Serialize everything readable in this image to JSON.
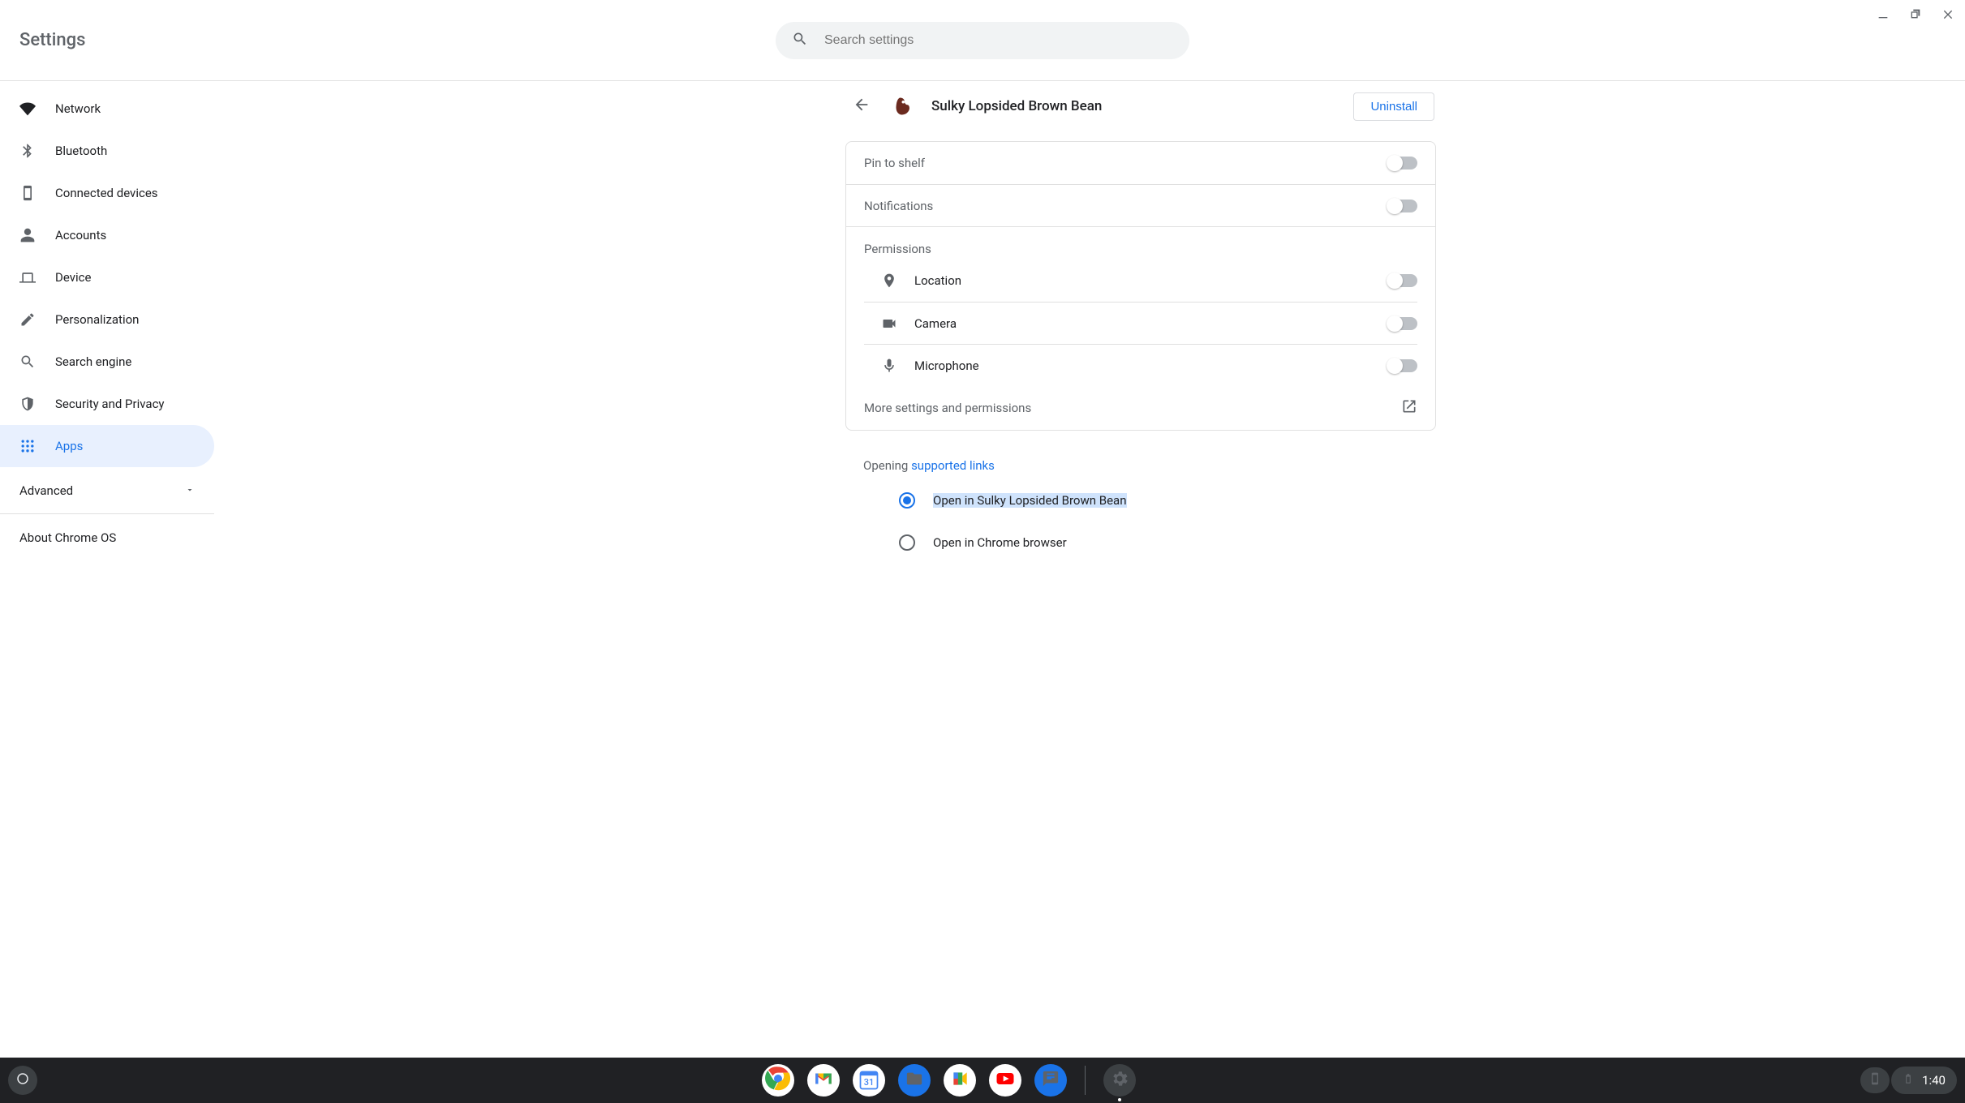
{
  "header": {
    "title": "Settings"
  },
  "search": {
    "placeholder": "Search settings"
  },
  "sidebar": {
    "items": [
      {
        "label": "Network"
      },
      {
        "label": "Bluetooth"
      },
      {
        "label": "Connected devices"
      },
      {
        "label": "Accounts"
      },
      {
        "label": "Device"
      },
      {
        "label": "Personalization"
      },
      {
        "label": "Search engine"
      },
      {
        "label": "Security and Privacy"
      },
      {
        "label": "Apps"
      }
    ],
    "advanced": "Advanced",
    "about": "About Chrome OS"
  },
  "detail": {
    "app_name": "Sulky Lopsided Brown Bean",
    "uninstall": "Uninstall",
    "pin_to_shelf": "Pin to shelf",
    "notifications": "Notifications",
    "permissions_title": "Permissions",
    "permissions": {
      "location": "Location",
      "camera": "Camera",
      "microphone": "Microphone"
    },
    "more_settings": "More settings and permissions",
    "opening_prefix": "Opening ",
    "opening_link": "supported links",
    "radio_open_in_app": "Open in Sulky Lopsided Brown Bean",
    "radio_open_in_chrome": "Open in Chrome browser"
  },
  "shelf": {
    "time": "1:40",
    "calendar_day": "31"
  }
}
